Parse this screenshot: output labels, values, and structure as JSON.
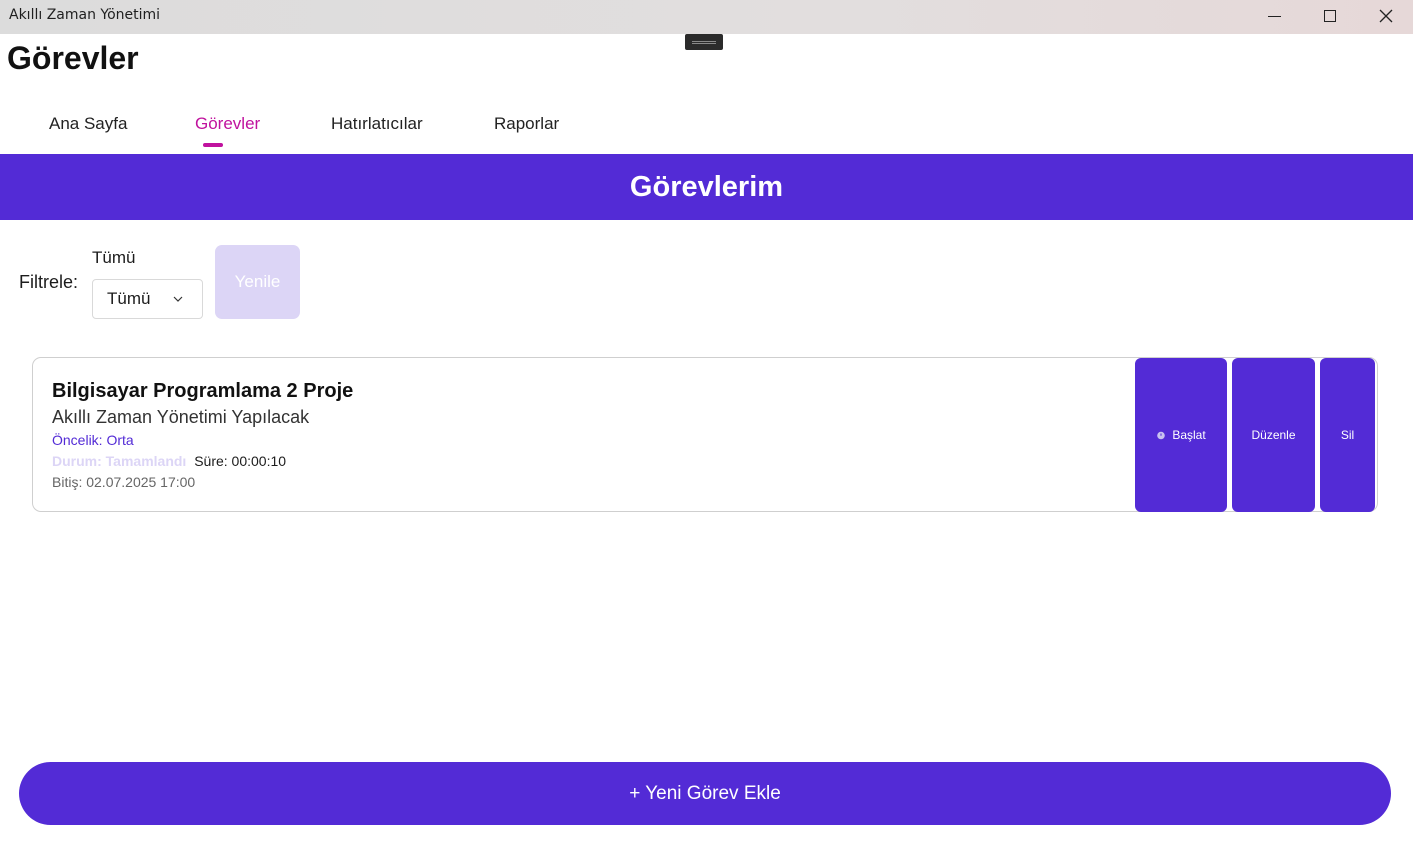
{
  "window": {
    "title": "Akıllı Zaman Yönetimi"
  },
  "page": {
    "title": "Görevler"
  },
  "nav": {
    "tabs": [
      {
        "label": "Ana Sayfa",
        "active": false
      },
      {
        "label": "Görevler",
        "active": true
      },
      {
        "label": "Hatırlatıcılar",
        "active": false
      },
      {
        "label": "Raporlar",
        "active": false
      }
    ]
  },
  "banner": {
    "title": "Görevlerim"
  },
  "filter": {
    "label": "Filtrele:",
    "header": "Tümü",
    "selected": "Tümü",
    "refresh_label": "Yenile"
  },
  "tasks": [
    {
      "title": "Bilgisayar Programlama 2 Proje",
      "description": "Akıllı Zaman Yönetimi Yapılacak",
      "priority": "Öncelik: Orta",
      "status": "Durum: Tamamlandı",
      "duration": "Süre: 00:00:10",
      "due": "Bitiş: 02.07.2025 17:00",
      "actions": {
        "start": "Başlat",
        "edit": "Düzenle",
        "delete": "Sil"
      }
    }
  ],
  "footer": {
    "add_label": "+ Yeni Görev Ekle"
  },
  "colors": {
    "accent": "#532bd6",
    "active_tab": "#c0129e",
    "disabled": "#dcd5f6"
  }
}
